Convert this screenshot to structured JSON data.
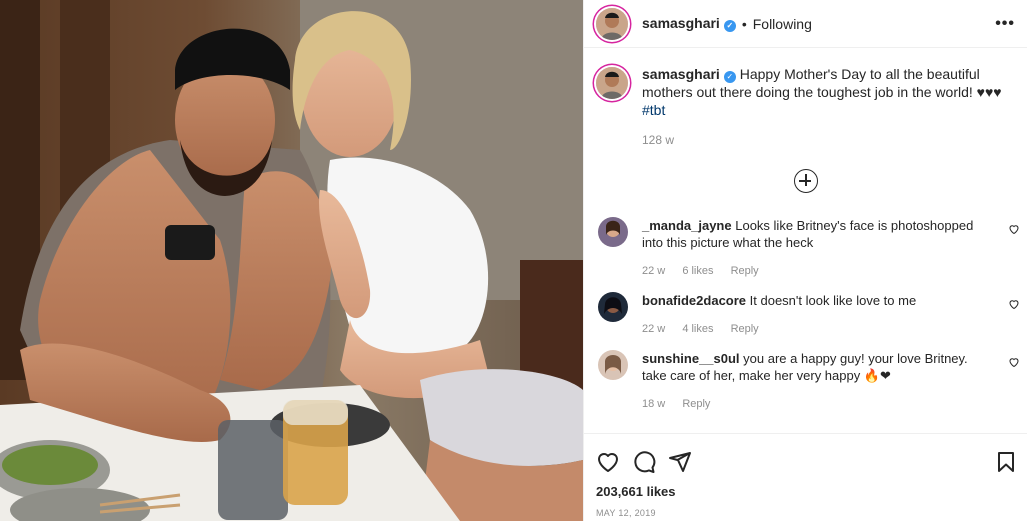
{
  "header": {
    "username": "samasghari",
    "verified_icon": "verified-badge-icon",
    "separator": "•",
    "follow_status": "Following",
    "more_icon": "more-options-icon"
  },
  "caption": {
    "username": "samasghari",
    "text": "Happy Mother's Day to all the beautiful mothers out there doing the toughest job in the world! ♥♥♥",
    "hashtag": "#tbt",
    "time": "128 w"
  },
  "load_more_icon": "plus-circle-icon",
  "comments": [
    {
      "username": "_manda_jayne",
      "text": "Looks like Britney's face is photoshopped into this picture what the heck",
      "time": "22 w",
      "likes": "6 likes",
      "reply": "Reply",
      "avatar_color": "#7a6a8a"
    },
    {
      "username": "bonafide2dacore",
      "text": "It doesn't look like love to me",
      "time": "22 w",
      "likes": "4 likes",
      "reply": "Reply",
      "avatar_color": "#1f2a3a"
    },
    {
      "username": "sunshine__s0ul",
      "text": "you are a happy guy! your love Britney. take care of her, make her very happy 🔥❤",
      "time": "18 w",
      "likes": "",
      "reply": "Reply",
      "avatar_color": "#d9c4b6"
    }
  ],
  "actions": {
    "like_icon": "heart-icon",
    "comment_icon": "comment-icon",
    "share_icon": "share-icon",
    "save_icon": "bookmark-icon"
  },
  "likes": "203,661 likes",
  "date": "MAY 12, 2019",
  "colors": {
    "link": "#00376b",
    "verified": "#3897f0",
    "muted": "#8e8e8e",
    "text": "#262626"
  }
}
